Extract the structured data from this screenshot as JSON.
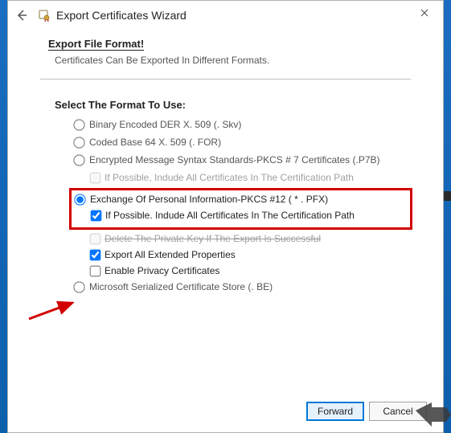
{
  "window": {
    "title": "Export Certificates Wizard"
  },
  "heading": "Export File Format!",
  "subheading": "Certificates Can Be Exported In Different Formats.",
  "select_label": "Select The Format To Use:",
  "options": {
    "der": "Binary Encoded DER X. 509 (. Skv)",
    "base64": "Coded Base 64 X. 509 (. FOR)",
    "pkcs7": "Encrypted Message Syntax Standards-PKCS # 7 Certificates (.P7B)",
    "pkcs7_include": "If Possible, Indude All Certificates In The Certification Path",
    "pfx": "Exchange Of Personal Information-PKCS #12 ( * . PFX)",
    "pfx_include": "If Possible. Indude All Certificates In The Certification Path",
    "pfx_delete": "Delete The Private Key If The Export Is Successful",
    "pfx_extended": "Export All Extended Properties",
    "pfx_privacy": "Enable Privacy Certificates",
    "mscs": "Microsoft Serialized Certificate Store (. BE)"
  },
  "buttons": {
    "forward": "Forward",
    "cancel": "Cancel"
  }
}
